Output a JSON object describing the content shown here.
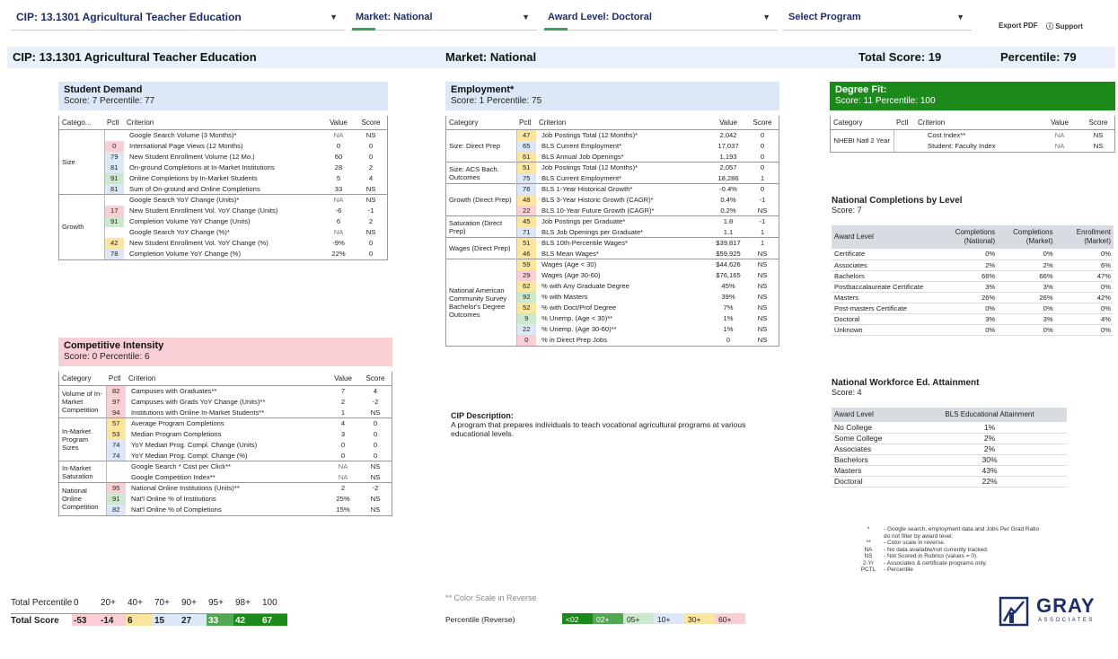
{
  "filters": {
    "cip": "CIP: 13.1301 Agricultural Teacher Education",
    "market": "Market: National",
    "award": "Award Level: Doctoral",
    "program": "Select Program",
    "export": "Export PDF",
    "support": "Support"
  },
  "header": {
    "cip": "CIP: 13.1301 Agricultural Teacher Education",
    "market": "Market: National",
    "total_score": "Total Score: 19",
    "percentile": "Percentile: 79"
  },
  "columns": {
    "category": "Category",
    "category_short": "Catego...",
    "pctl": "Pctl",
    "criterion": "Criterion",
    "value": "Value",
    "score": "Score"
  },
  "student_demand": {
    "title": "Student Demand",
    "sub": "Score: 7  Percentile: 77",
    "groups": [
      {
        "cat": "Size",
        "rows": [
          {
            "p": "",
            "c": "Google Search Volume (3 Months)*",
            "v": "NA",
            "s": "NS",
            "col": ""
          },
          {
            "p": "0",
            "c": "International Page Views (12 Months)",
            "v": "0",
            "s": "0",
            "col": "red"
          },
          {
            "p": "79",
            "c": "New Student Enrollment Volume (12 Mo.)",
            "v": "60",
            "s": "0",
            "col": "blue"
          },
          {
            "p": "81",
            "c": "On-ground Completions at In-Market Institutions",
            "v": "28",
            "s": "2",
            "col": "blue"
          },
          {
            "p": "91",
            "c": "Online Completions by In-Market Students",
            "v": "5",
            "s": "4",
            "col": "lgreen"
          },
          {
            "p": "81",
            "c": "Sum of On-ground and Online Completions",
            "v": "33",
            "s": "NS",
            "col": "blue"
          }
        ]
      },
      {
        "cat": "Growth",
        "rows": [
          {
            "p": "",
            "c": "Google Search YoY Change (Units)*",
            "v": "NA",
            "s": "NS",
            "col": ""
          },
          {
            "p": "17",
            "c": "New Student Enrollment Vol. YoY Change (Units)",
            "v": "-6",
            "s": "-1",
            "col": "red"
          },
          {
            "p": "91",
            "c": "Completion Volume YoY Change (Units)",
            "v": "6",
            "s": "2",
            "col": "lgreen"
          },
          {
            "p": "",
            "c": "Google Search YoY Change (%)*",
            "v": "NA",
            "s": "NS",
            "col": ""
          },
          {
            "p": "42",
            "c": "New Student Enrollment Vol. YoY Change (%)",
            "v": "-9%",
            "s": "0",
            "col": "yellow"
          },
          {
            "p": "78",
            "c": "Completion Volume YoY Change (%)",
            "v": "22%",
            "s": "0",
            "col": "blue"
          }
        ]
      }
    ]
  },
  "competitive": {
    "title": "Competitive Intensity",
    "sub": "Score: 0  Percentile: 6",
    "groups": [
      {
        "cat": "Volume of In-Market Competition",
        "rows": [
          {
            "p": "82",
            "c": "Campuses with Graduates**",
            "v": "7",
            "s": "4",
            "col": "red"
          },
          {
            "p": "97",
            "c": "Campuses with Grads YoY Change (Units)**",
            "v": "2",
            "s": "-2",
            "col": "red"
          },
          {
            "p": "94",
            "c": "Institutions with Online In-Market Students**",
            "v": "1",
            "s": "NS",
            "col": "red"
          }
        ]
      },
      {
        "cat": "In-Market Program Sizes",
        "rows": [
          {
            "p": "57",
            "c": "Average Program Completions",
            "v": "4",
            "s": "0",
            "col": "yellow"
          },
          {
            "p": "53",
            "c": "Median Program Completions",
            "v": "3",
            "s": "0",
            "col": "yellow"
          },
          {
            "p": "74",
            "c": "YoY Median Prog. Compl. Change (Units)",
            "v": "0",
            "s": "0",
            "col": "blue"
          },
          {
            "p": "74",
            "c": "YoY Median Prog. Compl. Change (%)",
            "v": "0",
            "s": "0",
            "col": "blue"
          }
        ]
      },
      {
        "cat": "In-Market Saturation",
        "rows": [
          {
            "p": "",
            "c": "Google Search * Cost per Click**",
            "v": "NA",
            "s": "NS",
            "col": ""
          },
          {
            "p": "",
            "c": "Google Competition Index**",
            "v": "NA",
            "s": "NS",
            "col": ""
          }
        ]
      },
      {
        "cat": "National Online Competition",
        "rows": [
          {
            "p": "95",
            "c": "National Online Institutions (Units)**",
            "v": "2",
            "s": "-2",
            "col": "red"
          },
          {
            "p": "91",
            "c": "Nat'l Online % of Institutions",
            "v": "25%",
            "s": "NS",
            "col": "lgreen"
          },
          {
            "p": "82",
            "c": "Nat'l Online % of Completions",
            "v": "15%",
            "s": "NS",
            "col": "blue"
          }
        ]
      }
    ]
  },
  "employment": {
    "title": "Employment*",
    "sub": "Score: 1  Percentile: 75",
    "groups": [
      {
        "cat": "Size: Direct Prep",
        "rows": [
          {
            "p": "47",
            "c": "Job Postings Total (12 Months)*",
            "v": "2,042",
            "s": "0",
            "col": "yellow"
          },
          {
            "p": "65",
            "c": "BLS Current Employment*",
            "v": "17,037",
            "s": "0",
            "col": "blue"
          },
          {
            "p": "61",
            "c": "BLS Annual Job Openings*",
            "v": "1,193",
            "s": "0",
            "col": "yellow"
          }
        ]
      },
      {
        "cat": "Size: ACS Bach. Outcomes",
        "rows": [
          {
            "p": "51",
            "c": "Job Postings Total (12 Months)*",
            "v": "2,057",
            "s": "0",
            "col": "yellow"
          },
          {
            "p": "75",
            "c": "BLS Current Employment*",
            "v": "18,286",
            "s": "1",
            "col": "blue"
          }
        ]
      },
      {
        "cat": "Growth (Direct Prep)",
        "rows": [
          {
            "p": "76",
            "c": "BLS 1-Year Historical Growth*",
            "v": "-0.4%",
            "s": "0",
            "col": "blue"
          },
          {
            "p": "48",
            "c": "BLS 3-Year Historic Growth (CAGR)*",
            "v": "0.4%",
            "s": "-1",
            "col": "yellow"
          },
          {
            "p": "22",
            "c": "BLS 10-Year Future Growth (CAGR)*",
            "v": "0.2%",
            "s": "NS",
            "col": "red"
          }
        ]
      },
      {
        "cat": "Saturation (Direct Prep)",
        "rows": [
          {
            "p": "45",
            "c": "Job Postings per Graduate*",
            "v": "1.8",
            "s": "-1",
            "col": "yellow"
          },
          {
            "p": "71",
            "c": "BLS Job Openings per Graduate*",
            "v": "1.1",
            "s": "1",
            "col": "blue"
          }
        ]
      },
      {
        "cat": "Wages (Direct Prep)",
        "rows": [
          {
            "p": "51",
            "c": "BLS 10th-Percentile Wages*",
            "v": "$39,817",
            "s": "1",
            "col": "yellow"
          },
          {
            "p": "46",
            "c": "BLS Mean Wages*",
            "v": "$59,925",
            "s": "NS",
            "col": "yellow"
          }
        ]
      },
      {
        "cat": "National American Community Survey Bachelor's Degree Outcomes",
        "rows": [
          {
            "p": "59",
            "c": "Wages (Age < 30)",
            "v": "$44,626",
            "s": "NS",
            "col": "yellow"
          },
          {
            "p": "29",
            "c": "Wages (Age 30-60)",
            "v": "$76,165",
            "s": "NS",
            "col": "red"
          },
          {
            "p": "62",
            "c": "% with Any Graduate Degree",
            "v": "45%",
            "s": "NS",
            "col": "yellow"
          },
          {
            "p": "92",
            "c": "% with Masters",
            "v": "39%",
            "s": "NS",
            "col": "lgreen"
          },
          {
            "p": "52",
            "c": "% with Doct/Prof Degree",
            "v": "7%",
            "s": "NS",
            "col": "yellow"
          },
          {
            "p": "9",
            "c": "% Unemp. (Age < 30)**",
            "v": "1%",
            "s": "NS",
            "col": "lgreen"
          },
          {
            "p": "22",
            "c": "% Unemp. (Age 30-60)**",
            "v": "1%",
            "s": "NS",
            "col": "blue"
          },
          {
            "p": "0",
            "c": "% in Direct Prep Jobs",
            "v": "0",
            "s": "NS",
            "col": "red"
          }
        ]
      }
    ]
  },
  "cip_desc": {
    "title": "CIP Description:",
    "text": "A program that prepares individuals to teach vocational agricultural programs at various educational levels."
  },
  "degree_fit": {
    "title": "Degree Fit:",
    "sub": "Score: 11  Percentile: 100",
    "cat": "NHEBI Natl 2 Year",
    "rows": [
      {
        "c": "Cost Index**",
        "v": "NA",
        "s": "NS"
      },
      {
        "c": "Student: Faculty Index",
        "v": "NA",
        "s": "NS"
      }
    ]
  },
  "completions": {
    "title": "National Completions by Level",
    "sub": "Score: 7",
    "headers": [
      "Award Level",
      "Completions (National)",
      "Completions (Market)",
      "Enrollment (Market)"
    ],
    "rows": [
      [
        "Certificate",
        "0%",
        "0%",
        "0%"
      ],
      [
        "Associates",
        "2%",
        "2%",
        "6%"
      ],
      [
        "Bachelors",
        "66%",
        "66%",
        "47%"
      ],
      [
        "Postbaccalaureate Certificate",
        "3%",
        "3%",
        "0%"
      ],
      [
        "Masters",
        "26%",
        "26%",
        "42%"
      ],
      [
        "Post-masters Certificate",
        "0%",
        "0%",
        "0%"
      ],
      [
        "Doctoral",
        "3%",
        "3%",
        "4%"
      ],
      [
        "Unknown",
        "0%",
        "0%",
        "0%"
      ]
    ]
  },
  "workforce": {
    "title": "National Workforce Ed. Attainment",
    "sub": "Score: 4",
    "headers": [
      "Award Level",
      "BLS Educational Attainment"
    ],
    "rows": [
      [
        "No College",
        "1%"
      ],
      [
        "Some College",
        "2%"
      ],
      [
        "Associates",
        "2%"
      ],
      [
        "Bachelors",
        "30%"
      ],
      [
        "Masters",
        "43%"
      ],
      [
        "Doctoral",
        "22%"
      ]
    ]
  },
  "notes": [
    [
      "*",
      "- Google search, employment data and Jobs Per Grad Ratio"
    ],
    [
      "",
      "  do not filter by award level."
    ],
    [
      "**",
      "- Color scale in reverse."
    ],
    [
      "NA",
      "- No data available/not currently tracked."
    ],
    [
      "NS",
      "- Not Scored in Rubrics (values = 0)."
    ],
    [
      "2-Yr",
      "- Associates & certificate programs only."
    ],
    [
      "PCTL",
      "- Percentile"
    ]
  ],
  "scale": {
    "pctl_label": "Total Percentile",
    "score_label": "Total Score",
    "pctl": [
      "0",
      "20+",
      "40+",
      "70+",
      "90+",
      "95+",
      "98+",
      "100"
    ],
    "score": [
      "-53",
      "-14",
      "6",
      "15",
      "27",
      "33",
      "42",
      "67"
    ],
    "reverse_note": "** Color Scale in Reverse",
    "reverse_label": "Percentile (Reverse)",
    "reverse": [
      "<02",
      "02+",
      "05+",
      "10+",
      "30+",
      "60+"
    ]
  },
  "logo": {
    "name": "GRAY",
    "sub": "ASSOCIATES"
  }
}
